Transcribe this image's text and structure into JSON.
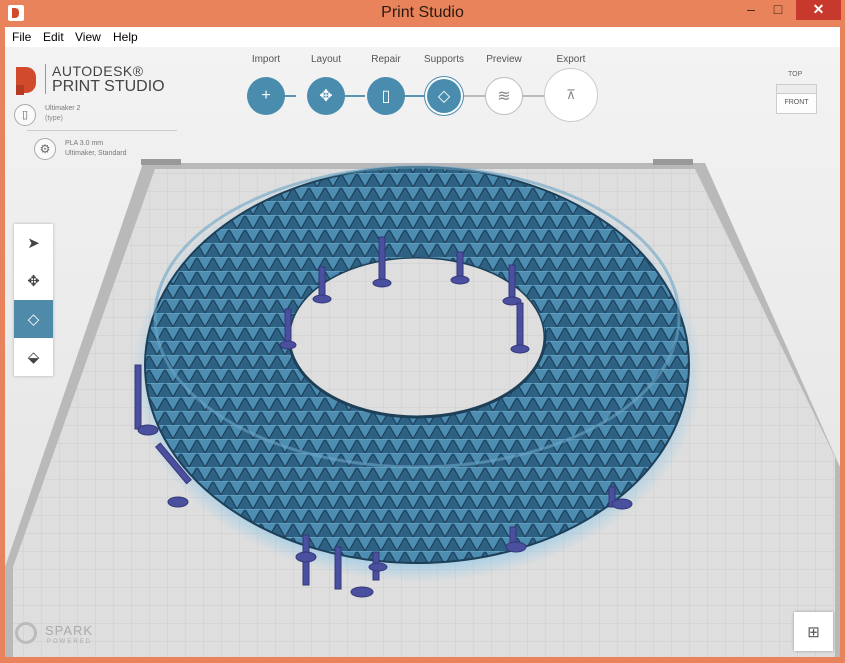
{
  "window": {
    "title": "Print Studio",
    "minimize": "–",
    "maximize": "□",
    "close": "✕"
  },
  "menu": {
    "items": [
      "File",
      "Edit",
      "View",
      "Help"
    ]
  },
  "brand": {
    "line1": "AUTODESK®",
    "line2": "PRINT STUDIO"
  },
  "machine": {
    "name": "Ultimaker 2",
    "type": "(type)"
  },
  "material": {
    "name": "PLA 3.0 mm",
    "profile": "Ultimaker, Standard"
  },
  "workflow": {
    "steps": [
      {
        "label": "Import",
        "icon": "plus-icon",
        "glyph": "+"
      },
      {
        "label": "Layout",
        "icon": "move-icon",
        "glyph": "✥"
      },
      {
        "label": "Repair",
        "icon": "document-icon",
        "glyph": "▯"
      },
      {
        "label": "Supports",
        "icon": "supports-icon",
        "glyph": "◇"
      },
      {
        "label": "Preview",
        "icon": "layers-icon",
        "glyph": "≋"
      },
      {
        "label": "Export",
        "icon": "export-icon",
        "glyph": "⊼"
      }
    ],
    "active": "Supports"
  },
  "view_cube": {
    "top": "TOP",
    "front": "FRONT"
  },
  "tools": [
    {
      "name": "select-tool",
      "icon": "arrow-icon",
      "glyph": "➤"
    },
    {
      "name": "move-tool",
      "icon": "move-icon",
      "glyph": "✥"
    },
    {
      "name": "supports-tool",
      "icon": "supports-icon",
      "glyph": "◇"
    },
    {
      "name": "support-edit-tool",
      "icon": "support-edit-icon",
      "glyph": "⬙"
    }
  ],
  "spark": {
    "text": "SPARK",
    "sub": "POWERED"
  },
  "colors": {
    "frame": "#e8835b",
    "accent": "#4a8cad",
    "model": "#3f7a9d",
    "supports": "#4a4f9e",
    "bed": "#dcdcdc"
  }
}
